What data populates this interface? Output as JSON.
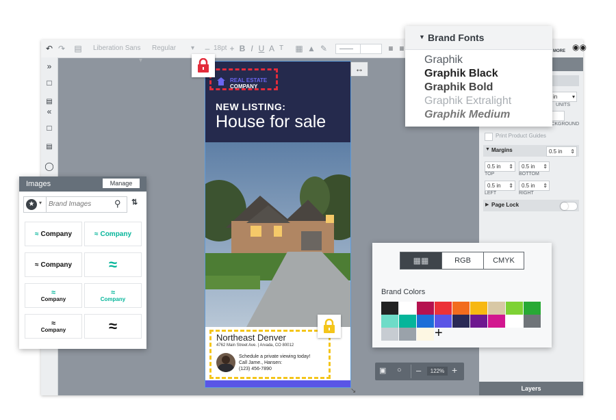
{
  "toolbar": {
    "font_name": "Liberation Sans",
    "font_style": "Regular",
    "font_size": "18pt"
  },
  "flyer": {
    "logo_line1": "REAL ESTATE",
    "logo_line2": "COMPANY",
    "headline_small": "NEW LISTING:",
    "headline_big": "House for sale",
    "neighborhood": "Northeast Denver",
    "address": "4762 Main Street Ave. | Arvada, CO 80012",
    "contact_line1": "Schedule a private viewing today!",
    "contact_line2": "Call Jame., Hansen:",
    "contact_phone": "(123) 456-7890"
  },
  "images_panel": {
    "title": "Images",
    "manage_label": "Manage",
    "search_placeholder": "Brand Images",
    "tiles": [
      "Company",
      "Company",
      "Company",
      "",
      "Company",
      "Company",
      "Company",
      ""
    ]
  },
  "fonts_panel": {
    "title": "Brand Fonts",
    "fonts": [
      "Graphik",
      "Graphik Black",
      "Graphik Bold",
      "Graphik Extralight",
      "Graphik Medium"
    ]
  },
  "colors_panel": {
    "tabs": [
      "",
      "RGB",
      "CMYK"
    ],
    "title": "Brand Colors",
    "add_label": "+",
    "swatches": [
      "#222222",
      "#ffffff",
      "#b5124f",
      "#ec3237",
      "#f26c1e",
      "#f7b812",
      "#d8c8a6",
      "#7ed235",
      "#28a935",
      "#6edcc8",
      "#05b59a",
      "#1c6fd8",
      "#5a55e6",
      "#2a2a56",
      "#6e1890",
      "#d2178f",
      "#ffffff",
      "#6f7479",
      "#c7ccd2",
      "#9aa2aa",
      "#fdf7e3"
    ]
  },
  "right_panel": {
    "more_label": "MORE",
    "units_value": "in",
    "units_label": "UNITS",
    "background_label": "BACKGROUND",
    "print_guides_label": "Print Product Guides",
    "margins_label": "Margins",
    "margins_value": "0.5 in",
    "margin_top_value": "0.5 in",
    "margin_top_label": "TOP",
    "margin_bottom_value": "0.5 in",
    "margin_bottom_label": "BOTTOM",
    "margin_left_value": "0.5 in",
    "margin_left_label": "LEFT",
    "margin_right_value": "0.5 in",
    "margin_right_label": "RIGHT",
    "page_lock_label": "Page Lock",
    "layers_label": "Layers"
  },
  "zoom": {
    "value": "122%"
  },
  "colors": {
    "flyer_navy": "#252a4d",
    "accent_purple": "#5a55e6",
    "lock_red": "#e32c3b",
    "lock_yellow": "#f4c51a",
    "brand_teal": "#05b59a"
  }
}
